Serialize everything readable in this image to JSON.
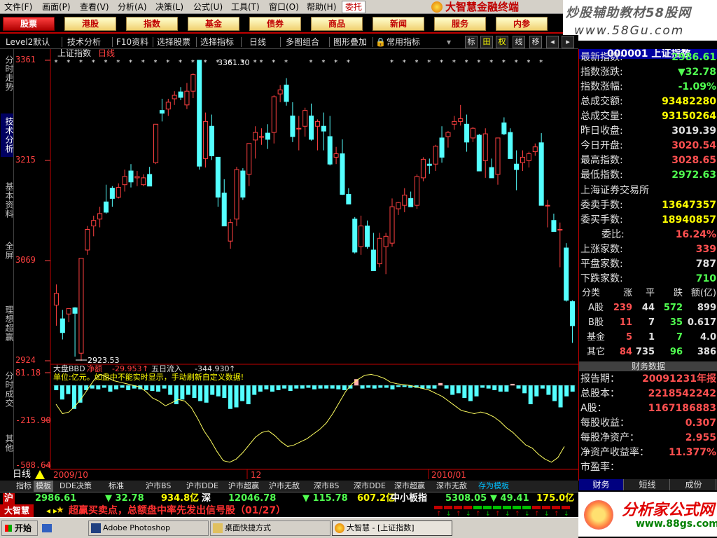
{
  "menu": [
    "文件(F)",
    "画面(P)",
    "查看(V)",
    "分析(A)",
    "决策(L)",
    "公式(U)",
    "工具(T)",
    "窗口(O)",
    "帮助(H)"
  ],
  "weituo": "委托",
  "brand": "大智慧金融终端",
  "watermark_top": {
    "line1": "炒股辅助教材58股网",
    "line2": "www.58Gu.com"
  },
  "topnav": [
    "股票",
    "港股",
    "指数",
    "基金",
    "债券",
    "商品",
    "新闻",
    "服务",
    "内参"
  ],
  "toolbar": {
    "items": [
      "Level2默认",
      "技术分析",
      "F10资料",
      "选择股票",
      "选择指标",
      "日线",
      "多图组合",
      "图形叠加",
      "常用指标"
    ],
    "icon_buttons": [
      "标",
      "田",
      "权",
      "线",
      "移"
    ]
  },
  "left_tabs": [
    "分时走势",
    "技术分析",
    "基本资料",
    "全屏",
    "理想超赢",
    "分时成交",
    "其他"
  ],
  "chart": {
    "title": "上证指数",
    "period_tag": "日线",
    "price_axis": [
      "3361",
      "3215",
      "3069",
      "2924"
    ],
    "high_label": "3361.30",
    "low_label": "2923.53",
    "indicator_name": "大盘BBD",
    "indicator_label1": "净额",
    "indicator_val1": "-29.953",
    "indicator_label2": "五日流入",
    "indicator_val2": "-344.930",
    "indicator_note": "单位:亿元。如盘中不能实时显示，手动刷新自定义数据!",
    "indicator_axis": [
      "81.18",
      "-215.90",
      "-508.64"
    ],
    "date_labels": [
      "2009/10",
      "12",
      "2010/01"
    ],
    "period_label": "日线",
    "up_color": "#ff4040",
    "down_color": "#54ffff"
  },
  "chart_data": {
    "type": "candlestick",
    "title": "上证指数",
    "ylim": [
      2924,
      3361
    ],
    "candles": [
      {
        "o": 3005,
        "h": 3035,
        "l": 2975,
        "c": 3022
      },
      {
        "o": 2985,
        "h": 2998,
        "l": 2955,
        "c": 2965
      },
      {
        "o": 2992,
        "h": 3000,
        "l": 2980,
        "c": 3000
      },
      {
        "o": 3001,
        "h": 3002,
        "l": 2930,
        "c": 2993
      },
      {
        "o": 2935,
        "h": 3070,
        "l": 2924,
        "c": 3073
      },
      {
        "o": 3085,
        "h": 3120,
        "l": 3078,
        "c": 3115
      },
      {
        "o": 3120,
        "h": 3135,
        "l": 3105,
        "c": 3128
      },
      {
        "o": 3130,
        "h": 3148,
        "l": 3118,
        "c": 3138
      },
      {
        "o": 3155,
        "h": 3180,
        "l": 3138,
        "c": 3140
      },
      {
        "o": 3175,
        "h": 3178,
        "l": 3148,
        "c": 3160
      },
      {
        "o": 3162,
        "h": 3182,
        "l": 3160,
        "c": 3176
      },
      {
        "o": 3180,
        "h": 3202,
        "l": 3170,
        "c": 3192
      },
      {
        "o": 3200,
        "h": 3210,
        "l": 3176,
        "c": 3184
      },
      {
        "o": 3190,
        "h": 3200,
        "l": 3178,
        "c": 3192
      },
      {
        "o": 3180,
        "h": 3195,
        "l": 3178,
        "c": 3190
      },
      {
        "o": 3195,
        "h": 3206,
        "l": 3178,
        "c": 3178
      },
      {
        "o": 3212,
        "h": 3268,
        "l": 3210,
        "c": 3268
      },
      {
        "o": 3288,
        "h": 3305,
        "l": 3272,
        "c": 3284
      },
      {
        "o": 3290,
        "h": 3305,
        "l": 3280,
        "c": 3300
      },
      {
        "o": 3305,
        "h": 3316,
        "l": 3296,
        "c": 3310
      },
      {
        "o": 3315,
        "h": 3322,
        "l": 3303,
        "c": 3307
      },
      {
        "o": 3296,
        "h": 3328,
        "l": 3290,
        "c": 3316
      },
      {
        "o": 3316,
        "h": 3342,
        "l": 3306,
        "c": 3340
      },
      {
        "o": 3361,
        "h": 3361,
        "l": 3202,
        "c": 3207
      },
      {
        "o": 3218,
        "h": 3285,
        "l": 3205,
        "c": 3272
      },
      {
        "o": 3265,
        "h": 3282,
        "l": 3216,
        "c": 3222
      },
      {
        "o": 3220,
        "h": 3220,
        "l": 3148,
        "c": 3162
      },
      {
        "o": 3168,
        "h": 3188,
        "l": 3120,
        "c": 3120
      },
      {
        "o": 3098,
        "h": 3130,
        "l": 3087,
        "c": 3125
      },
      {
        "o": 3130,
        "h": 3206,
        "l": 3120,
        "c": 3202
      },
      {
        "o": 3200,
        "h": 3204,
        "l": 3158,
        "c": 3162
      },
      {
        "o": 3195,
        "h": 3240,
        "l": 3178,
        "c": 3240
      },
      {
        "o": 3245,
        "h": 3265,
        "l": 3218,
        "c": 3256
      },
      {
        "o": 3250,
        "h": 3262,
        "l": 3238,
        "c": 3250
      },
      {
        "o": 3255,
        "h": 3268,
        "l": 3232,
        "c": 3246
      },
      {
        "o": 3256,
        "h": 3310,
        "l": 3240,
        "c": 3308
      },
      {
        "o": 3312,
        "h": 3325,
        "l": 3300,
        "c": 3318
      },
      {
        "o": 3325,
        "h": 3335,
        "l": 3295,
        "c": 3301
      },
      {
        "o": 3280,
        "h": 3300,
        "l": 3242,
        "c": 3250
      },
      {
        "o": 3262,
        "h": 3280,
        "l": 3230,
        "c": 3262
      },
      {
        "o": 3265,
        "h": 3292,
        "l": 3250,
        "c": 3288
      },
      {
        "o": 3280,
        "h": 3298,
        "l": 3244,
        "c": 3246
      },
      {
        "o": 3265,
        "h": 3275,
        "l": 3230,
        "c": 3272
      },
      {
        "o": 3265,
        "h": 3285,
        "l": 3230,
        "c": 3258
      },
      {
        "o": 3250,
        "h": 3280,
        "l": 3208,
        "c": 3210
      },
      {
        "o": 3220,
        "h": 3235,
        "l": 3210,
        "c": 3225
      },
      {
        "o": 3225,
        "h": 3246,
        "l": 3165,
        "c": 3166
      },
      {
        "o": 3166,
        "h": 3175,
        "l": 3152,
        "c": 3152
      },
      {
        "o": 3130,
        "h": 3133,
        "l": 3080,
        "c": 3082
      },
      {
        "o": 3090,
        "h": 3135,
        "l": 3078,
        "c": 3120
      },
      {
        "o": 3120,
        "h": 3128,
        "l": 3087,
        "c": 3090
      },
      {
        "o": 3085,
        "h": 3110,
        "l": 3055,
        "c": 3055
      },
      {
        "o": 3065,
        "h": 3110,
        "l": 3060,
        "c": 3102
      },
      {
        "o": 3090,
        "h": 3110,
        "l": 3050,
        "c": 3105
      },
      {
        "o": 3095,
        "h": 3160,
        "l": 3090,
        "c": 3148
      },
      {
        "o": 3145,
        "h": 3155,
        "l": 3136,
        "c": 3154
      },
      {
        "o": 3150,
        "h": 3175,
        "l": 3140,
        "c": 3165
      },
      {
        "o": 3160,
        "h": 3170,
        "l": 3148,
        "c": 3148
      },
      {
        "o": 3150,
        "h": 3195,
        "l": 3145,
        "c": 3192
      },
      {
        "o": 3190,
        "h": 3220,
        "l": 3185,
        "c": 3217
      },
      {
        "o": 3210,
        "h": 3218,
        "l": 3196,
        "c": 3208
      },
      {
        "o": 3210,
        "h": 3238,
        "l": 3200,
        "c": 3236
      },
      {
        "o": 3248,
        "h": 3265,
        "l": 3212,
        "c": 3220
      },
      {
        "o": 3250,
        "h": 3258,
        "l": 3234,
        "c": 3256
      },
      {
        "o": 3268,
        "h": 3280,
        "l": 3260,
        "c": 3272
      },
      {
        "o": 3272,
        "h": 3296,
        "l": 3266,
        "c": 3276
      },
      {
        "o": 3268,
        "h": 3282,
        "l": 3228,
        "c": 3242
      },
      {
        "o": 3248,
        "h": 3264,
        "l": 3242,
        "c": 3262
      },
      {
        "o": 3252,
        "h": 3254,
        "l": 3200,
        "c": 3200
      },
      {
        "o": 3215,
        "h": 3262,
        "l": 3190,
        "c": 3254
      },
      {
        "o": 3205,
        "h": 3218,
        "l": 3190,
        "c": 3190
      },
      {
        "o": 3195,
        "h": 3235,
        "l": 3180,
        "c": 3248
      },
      {
        "o": 3270,
        "h": 3278,
        "l": 3252,
        "c": 3254
      },
      {
        "o": 3256,
        "h": 3262,
        "l": 3218,
        "c": 3218
      },
      {
        "o": 3210,
        "h": 3230,
        "l": 3172,
        "c": 3202
      },
      {
        "o": 3212,
        "h": 3230,
        "l": 3200,
        "c": 3220
      },
      {
        "o": 3215,
        "h": 3228,
        "l": 3205,
        "c": 3225
      },
      {
        "o": 3228,
        "h": 3240,
        "l": 3222,
        "c": 3235
      },
      {
        "o": 3241,
        "h": 3255,
        "l": 3150,
        "c": 3150
      },
      {
        "o": 3150,
        "h": 3158,
        "l": 3118,
        "c": 3150
      },
      {
        "o": 3128,
        "h": 3138,
        "l": 3112,
        "c": 3112
      },
      {
        "o": 3115,
        "h": 3125,
        "l": 3060,
        "c": 3115
      },
      {
        "o": 3088,
        "h": 3095,
        "l": 3010,
        "c": 3012
      },
      {
        "o": 3010,
        "h": 3012,
        "l": 2950,
        "c": 2975
      }
    ],
    "bbd": {
      "ylim": [
        -508.64,
        81.18
      ],
      "bars": [
        -30,
        -90,
        -55,
        -150,
        -110,
        -30,
        -20,
        -25,
        -15,
        -40,
        -25,
        -15,
        -30,
        -20,
        -25,
        -30,
        -35,
        -40,
        -20,
        -60,
        -120,
        -90,
        -60,
        -80,
        -100,
        -110,
        -60,
        -70,
        -80,
        -150,
        -140,
        -100,
        -120,
        -60,
        -40,
        -25,
        -40,
        -30,
        -20,
        -35,
        -20,
        -20,
        -15,
        -25,
        -20,
        -20,
        -20,
        -25,
        -30,
        -20,
        40,
        -20,
        -15,
        -20,
        -15,
        -15,
        -25,
        -10,
        -10,
        -15,
        -15,
        -20,
        -20,
        -20,
        15,
        -20,
        -60,
        -50,
        -80,
        -100,
        -70,
        -15,
        -20,
        -30,
        -40,
        -40,
        10,
        -20,
        -50,
        -120,
        -70,
        -20,
        -60,
        -100,
        -140,
        -70,
        -40
      ],
      "line": [
        -120,
        -180,
        -170,
        -130,
        -80,
        -20,
        40,
        70,
        50,
        30,
        20,
        10,
        0,
        -10,
        -40,
        -80,
        -100,
        -130,
        -110,
        -90,
        -100,
        -140,
        -210,
        -290,
        -350,
        -420,
        -480,
        -490,
        -470,
        -430,
        -380,
        -330,
        -300,
        -290,
        -320,
        -360,
        -390,
        -380,
        -360,
        -340,
        -310,
        -280,
        -240,
        -180,
        -110,
        -40,
        10,
        40,
        65,
        70,
        60,
        45,
        20,
        10,
        5,
        0,
        -10,
        -20,
        -30,
        -50,
        -70,
        -100,
        -130,
        -160,
        -170,
        -180,
        -170,
        -180,
        -200,
        -230,
        -270,
        -300,
        -340,
        -380,
        -400,
        -440,
        -470,
        -490,
        -460,
        -390
      ]
    }
  },
  "right_panel": {
    "title_text": "000001 上证指数",
    "rows": [
      {
        "label": "最新指数:",
        "value": "2986.61",
        "color": "down"
      },
      {
        "label": "指数涨跌:",
        "value": "▼32.78",
        "color": "down"
      },
      {
        "label": "指数涨幅:",
        "value": "-1.09%",
        "color": "down"
      },
      {
        "label": "总成交额:",
        "value": "93482280",
        "color": "yel"
      },
      {
        "label": "总成交量:",
        "value": "93150264",
        "color": "yel"
      },
      {
        "label": "昨日收盘:",
        "value": "3019.39",
        "color": "flat"
      },
      {
        "label": "今日开盘:",
        "value": "3020.54",
        "color": "up"
      },
      {
        "label": "最高指数:",
        "value": "3028.65",
        "color": "up"
      },
      {
        "label": "最低指数:",
        "value": "2972.63",
        "color": "down"
      }
    ],
    "exchange": "上海证券交易所",
    "rows2": [
      {
        "label": "委卖手数:",
        "value": "13647357",
        "color": "yel"
      },
      {
        "label": "委买手数:",
        "value": "18940857",
        "color": "yel"
      },
      {
        "label": "委比:",
        "value": "16.24%",
        "color": "up"
      },
      {
        "label": "上涨家数:",
        "value": "339",
        "color": "up"
      },
      {
        "label": "平盘家数:",
        "value": "787",
        "color": "flat"
      },
      {
        "label": "下跌家数:",
        "value": "710",
        "color": "down"
      }
    ],
    "counts_header": [
      "分类",
      "涨",
      "平",
      "跌",
      "额(亿)"
    ],
    "counts": [
      {
        "name": "A股",
        "up": "239",
        "flat": "44",
        "down": "572",
        "amt": "899"
      },
      {
        "name": "B股",
        "up": "11",
        "flat": "7",
        "down": "35",
        "amt": "0.617"
      },
      {
        "name": "基金",
        "up": "5",
        "flat": "1",
        "down": "7",
        "amt": "4.0"
      },
      {
        "name": "其它",
        "up": "84",
        "flat": "735",
        "down": "96",
        "amt": "386"
      }
    ],
    "fin_header": "财务数据",
    "fin": [
      {
        "label": "报告期：",
        "value": "20091231年报",
        "color": "up"
      },
      {
        "label": "总股本：",
        "value": "2218542242",
        "color": "up"
      },
      {
        "label": "A股：",
        "value": "1167186883",
        "color": "up"
      },
      {
        "label": "每股收益：",
        "value": "0.307",
        "color": "up"
      },
      {
        "label": "每股净资产：",
        "value": "2.955",
        "color": "up"
      },
      {
        "label": "净资产收益率：",
        "value": "11.377%",
        "color": "up"
      },
      {
        "label": "市盈率：",
        "value": "",
        "color": "up"
      }
    ],
    "tabs": [
      "财务",
      "短线",
      "成份"
    ]
  },
  "bottom_tabs": [
    "指标",
    "模板",
    "DDE决策",
    "标准",
    "沪市BS",
    "沪市DDE",
    "沪市超赢",
    "沪市无敌",
    "深市BS",
    "深市DDE",
    "深市超赢",
    "深市无敌",
    "存为模板"
  ],
  "ticker": [
    {
      "name": "沪",
      "price": "2986.61",
      "change": "▼ 32.78",
      "amount": "934.8亿"
    },
    {
      "name": "深",
      "price": "12046.78",
      "change": "▼ 115.78",
      "amount": "607.2亿"
    },
    {
      "name": "中小板指",
      "price": "5308.05",
      "change": "▼ 49.41",
      "amount": "175.0亿"
    }
  ],
  "status": {
    "logo": "大智慧",
    "hint": "◂ ▸",
    "text": "超赢买卖点，总额盘中率先发出信号股（01/27）"
  },
  "watermark_bottom": {
    "line1": "分析家公式网",
    "line2": "www.88gs.com"
  },
  "taskbar": {
    "start": "开始",
    "buttons": [
      "Adobe Photoshop",
      "桌面快捷方式",
      "大智慧 - [上证指数]"
    ]
  }
}
